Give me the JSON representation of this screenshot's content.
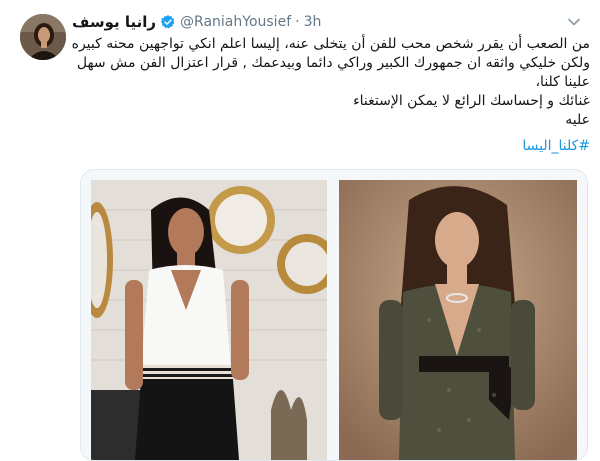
{
  "user": {
    "display_name": "رانيا يوسف",
    "handle": "@RaniahYousief",
    "separator": "·",
    "time": "3h"
  },
  "tweet": {
    "lines": [
      "من الصعب أن يقرر شخص محب للفن أن يتخلى عنه، إليسا اعلم انكي تواجهين محنه كبيره",
      "ولكن خليكي واثقه ان جمهورك الكبير وراكي دائما وبيدعمك , قرار اعتزال الفن مش سهل",
      "علينا كلنا،",
      "غنائك و إحساسك الرائع  لا يمكن الإستغناء",
      "عليه"
    ],
    "hashtag": "#كلنا_اليسا"
  },
  "icons": {
    "verified": "verified-badge-icon",
    "caret": "chevron-down-icon"
  },
  "colors": {
    "link": "#1b95e0",
    "verified": "#1da1f2",
    "muted": "#657786"
  }
}
